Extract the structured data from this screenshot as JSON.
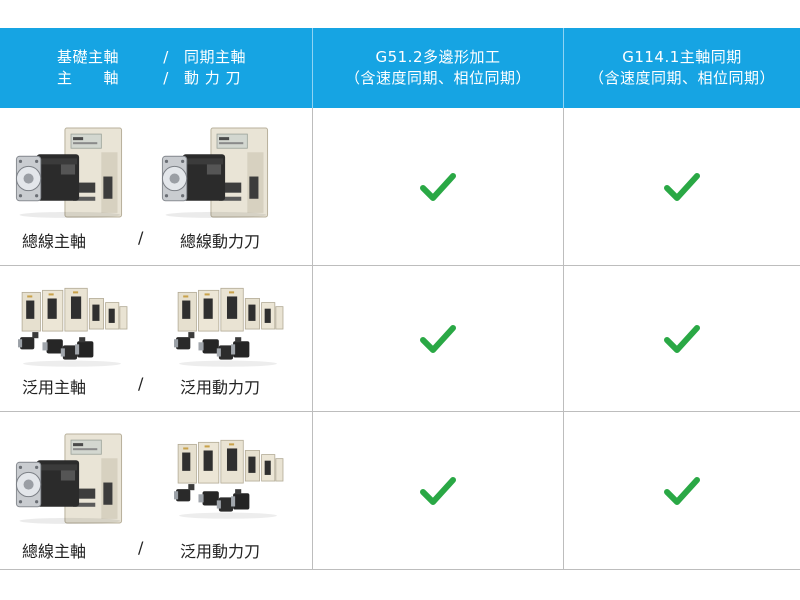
{
  "header": {
    "col1": {
      "left_top": "基礎主軸",
      "left_bottom": "主　　軸",
      "slash": "/",
      "right_top": "同期主軸",
      "right_bottom": "動 力 刀"
    },
    "col2": {
      "line1": "G51.2多邊形加工",
      "line2": "（含速度同期、相位同期）"
    },
    "col3": {
      "line1": "G114.1主軸同期",
      "line2": "（含速度同期、相位同期）"
    }
  },
  "rows": [
    {
      "left_label": "總線主軸",
      "slash": "/",
      "right_label": "總線動力刀",
      "left_image": "bus-servo-drive-and-spindle-motor",
      "right_image": "bus-servo-drive-and-spindle-motor",
      "col2": "check-icon",
      "col3": "check-icon"
    },
    {
      "left_label": "泛用主軸",
      "slash": "/",
      "right_label": "泛用動力刀",
      "left_image": "general-purpose-servo-drives-and-motors",
      "right_image": "general-purpose-servo-drives-and-motors",
      "col2": "check-icon",
      "col3": "check-icon"
    },
    {
      "left_label": "總線主軸",
      "slash": "/",
      "right_label": "泛用動力刀",
      "left_image": "bus-servo-drive-and-spindle-motor",
      "right_image": "general-purpose-servo-drives-and-motors",
      "col2": "check-icon",
      "col3": "check-icon"
    }
  ],
  "colors": {
    "header_bg": "#16a4e3",
    "check": "#2aa845",
    "grid": "#bdbdbd"
  }
}
